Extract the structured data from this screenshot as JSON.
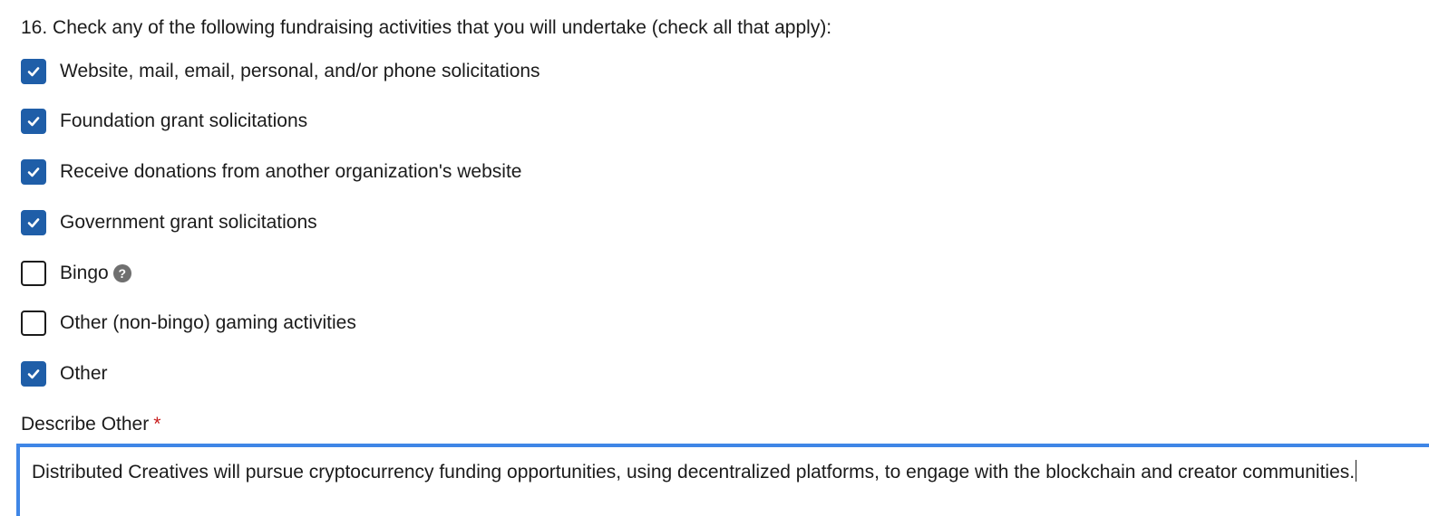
{
  "question": {
    "text": "16. Check any of the following fundraising activities that you will undertake (check all that apply):"
  },
  "options": [
    {
      "label": "Website, mail, email, personal, and/or phone solicitations",
      "checked": true
    },
    {
      "label": "Foundation grant solicitations",
      "checked": true
    },
    {
      "label": "Receive donations from another organization's website",
      "checked": true
    },
    {
      "label": "Government grant solicitations",
      "checked": true
    },
    {
      "label": "Bingo",
      "checked": false,
      "help_icon": "question-circle-icon"
    },
    {
      "label": "Other (non-bingo) gaming activities",
      "checked": false
    },
    {
      "label": "Other",
      "checked": true
    }
  ],
  "describe_other": {
    "label": "Describe Other",
    "required_marker": "*",
    "value": "Distributed Creatives will pursue cryptocurrency funding opportunities, using decentralized platforms, to engage with the blockchain and creator communities."
  },
  "colors": {
    "checkbox_checked": "#1f5ea8",
    "focus_border": "#3f86e6",
    "required": "#c81d1d",
    "help_icon": "#6f6f6f"
  }
}
